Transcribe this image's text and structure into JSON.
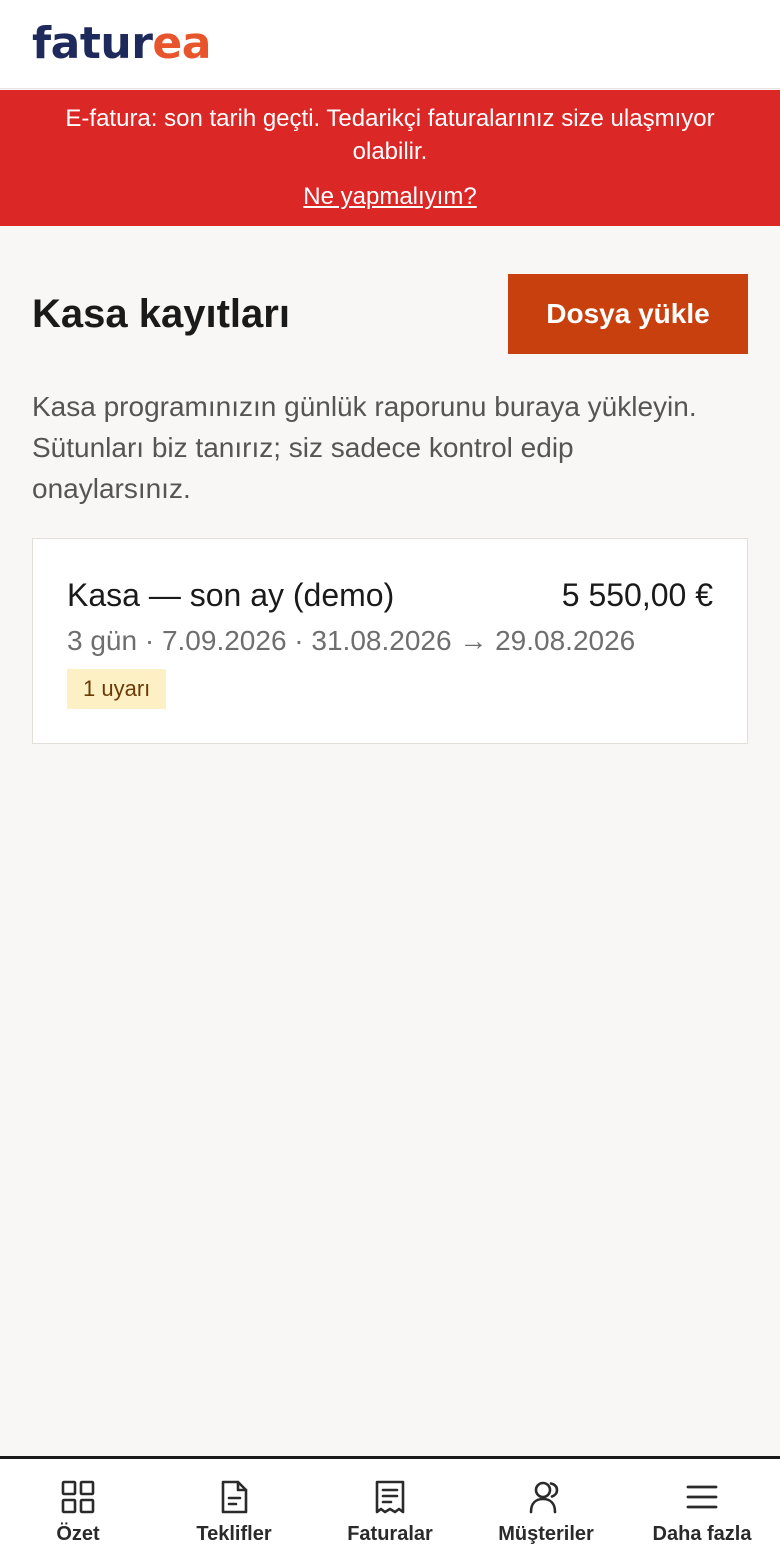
{
  "app": {
    "logo_part1": "fatur",
    "logo_part2": "ea"
  },
  "banner": {
    "message": "E-fatura: son tarih geçti. Tedarikçi faturalarınız size ulaşmıyor olabilir.",
    "link": "Ne yapmalıyım?"
  },
  "page": {
    "title": "Kasa kayıtları",
    "upload_button": "Dosya yükle",
    "description": "Kasa programınızın günlük raporunu buraya yükleyin. Sütunları biz tanırız; siz sadece kontrol edip onaylarsınız."
  },
  "records": [
    {
      "title": "Kasa — son ay (demo)",
      "amount": "5 550,00 €",
      "meta": "3 gün · 7.09.2026 · 31.08.2026 → 29.08.2026",
      "badge": "1 uyarı"
    }
  ],
  "nav": {
    "items": [
      {
        "label": "Özet",
        "icon": "grid-icon"
      },
      {
        "label": "Teklifler",
        "icon": "document-icon"
      },
      {
        "label": "Faturalar",
        "icon": "receipt-icon"
      },
      {
        "label": "Müşteriler",
        "icon": "users-icon"
      },
      {
        "label": "Daha fazla",
        "icon": "menu-icon"
      }
    ]
  },
  "colors": {
    "brand_dark": "#1f2a5c",
    "brand_accent": "#e8542c",
    "banner_bg": "#dc2727",
    "button_bg": "#c9400f",
    "badge_bg": "#fdf0c4"
  }
}
